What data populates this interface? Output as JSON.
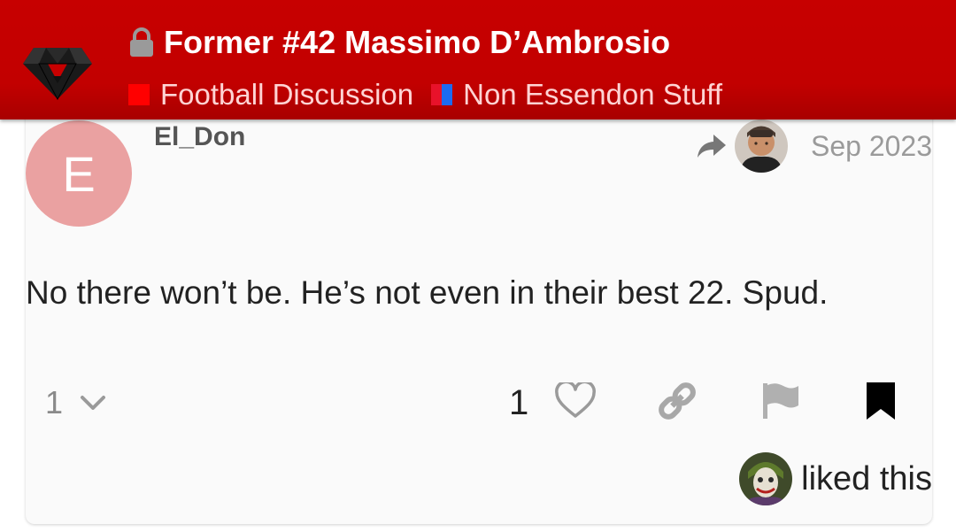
{
  "header": {
    "logo_icon": "essendon-diamond-logo-icon",
    "lock_icon": "lock-icon",
    "topic_title": "Former #42 Massimo D’Ambrosio",
    "categories": [
      {
        "name": "Football Discussion",
        "colors": [
          "#ff0000"
        ]
      },
      {
        "name": "Non Essendon Stuff",
        "colors": [
          "#e8122a",
          "#1c6bf2"
        ]
      }
    ],
    "colors": {
      "background": "#c40000",
      "title": "#ffffff",
      "category_text": "#ffd4d4"
    }
  },
  "post": {
    "avatar_letter": "E",
    "avatar_color": "#eaa1a1",
    "username": "El_Don",
    "reply_to_icon": "share-arrow-icon",
    "reply_to_avatar": "user-avatar-photo",
    "date": "Sep 2023",
    "body": "No there won’t be. He’s not even in their best 22. Spud."
  },
  "actions": {
    "replies_count": "1",
    "replies_toggle_icon": "chevron-down-icon",
    "like_count": "1",
    "icons": [
      "heart-icon",
      "link-icon",
      "flag-icon",
      "bookmark-icon"
    ]
  },
  "likes": {
    "liker_avatar": "joker-avatar-photo",
    "text": "liked this"
  }
}
